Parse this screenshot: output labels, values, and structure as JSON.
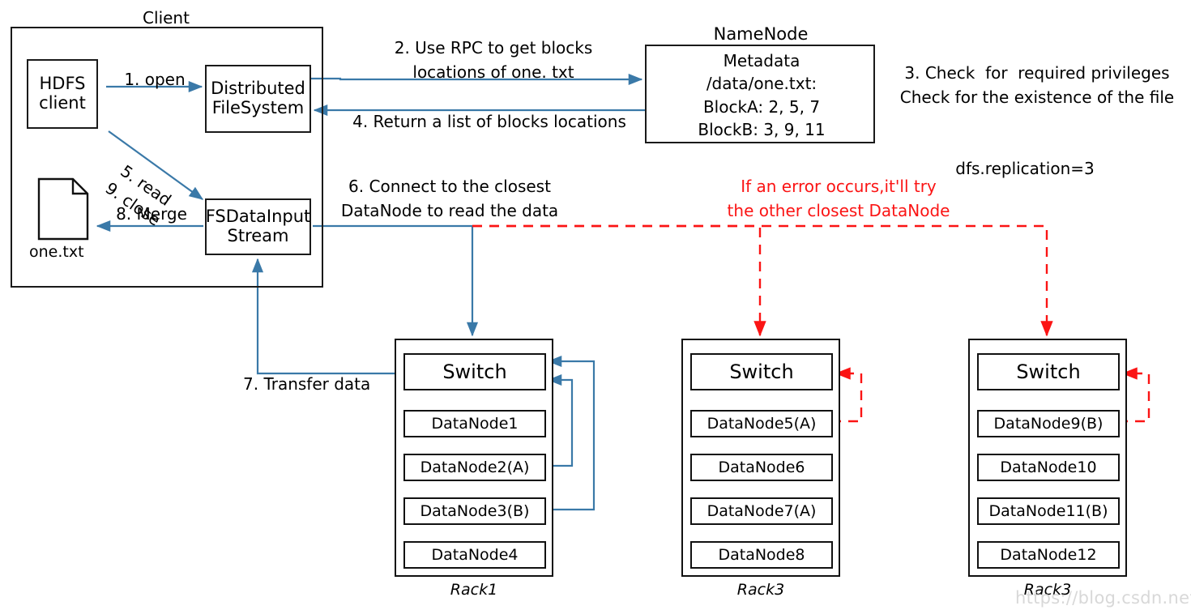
{
  "colors": {
    "blue_arrow": "#3a79a8",
    "red_dashed": "#fb1414",
    "box_border": "#111111",
    "text": "#000000",
    "watermark": "#d8d8d8"
  },
  "client": {
    "title": "Client",
    "hdfs_client": "HDFS\nclient",
    "distributed_filesystem": "Distributed\nFileSystem",
    "fsdatainput_stream": "FSDataInput\nStream",
    "output_file_name": "one.txt"
  },
  "namenode": {
    "title": "NameNode",
    "metadata_label": "Metadata",
    "path": "/data/one.txt:",
    "block_a": "BlockA: 2, 5, 7",
    "block_b": "BlockB: 3, 9, 11"
  },
  "steps": {
    "s1": "1. open",
    "s2": "2. Use RPC to get blocks\nlocations of one. txt",
    "s3": "3. Check  for  required privileges\nCheck for the existence of the file",
    "s4": "4. Return a list of blocks locations",
    "s5_9": "5. read\n9. close",
    "s6": "6. Connect to the closest\nDataNode to read the data",
    "s7": "7. Transfer data",
    "s8": "8. Merge"
  },
  "annotations": {
    "replication": "dfs.replication=3",
    "error_note": "If an error occurs,it'll try\nthe other closest DataNode"
  },
  "racks": [
    {
      "label": "Rack1",
      "switch": "Switch",
      "nodes": [
        "DataNode1",
        "DataNode2(A)",
        "DataNode3(B)",
        "DataNode4"
      ]
    },
    {
      "label": "Rack3",
      "switch": "Switch",
      "nodes": [
        "DataNode5(A)",
        "DataNode6",
        "DataNode7(A)",
        "DataNode8"
      ]
    },
    {
      "label": "Rack3",
      "switch": "Switch",
      "nodes": [
        "DataNode9(B)",
        "DataNode10",
        "DataNode11(B)",
        "DataNode12"
      ]
    }
  ],
  "watermark": "https://blog.csdn.net/H_X_P_"
}
